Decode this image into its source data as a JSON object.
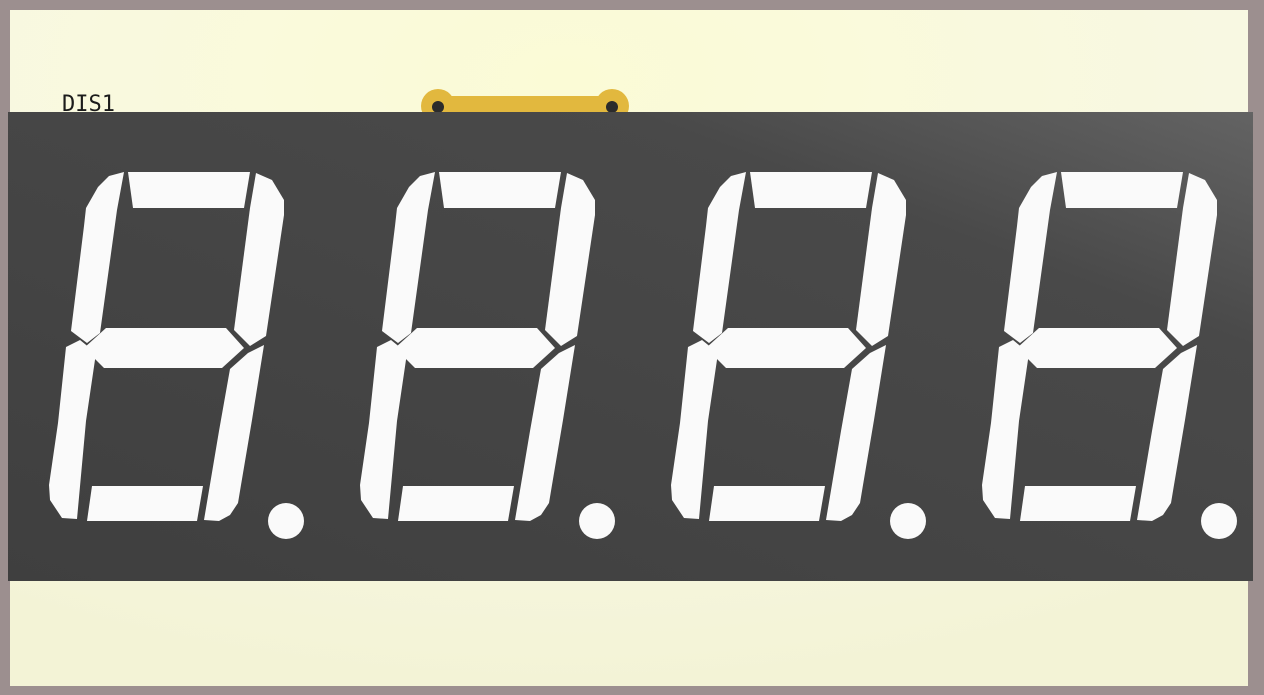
{
  "board": {
    "reference_designator": "DIS1",
    "colors": {
      "frame": "#9c8f8f",
      "board": "#f7f7d8",
      "pad": "#e2b83e",
      "display_body": "#4b4b4b",
      "segment": "#fafafa"
    }
  },
  "display": {
    "digits": 4,
    "segments_per_digit": [
      "a",
      "b",
      "c",
      "d",
      "e",
      "f",
      "g"
    ],
    "decimal_points": true,
    "shown_digit": "8"
  },
  "icons": [
    "seven-segment-digit-icon",
    "decimal-point-icon",
    "solder-pad-icon"
  ]
}
